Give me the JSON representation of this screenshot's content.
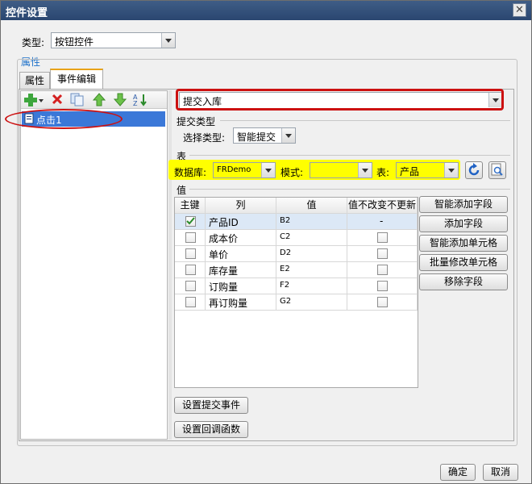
{
  "window": {
    "title": "控件设置",
    "close": "✕"
  },
  "type_row": {
    "label": "类型:",
    "value": "按钮控件"
  },
  "properties": {
    "section_label": "属性",
    "tabs": [
      "属性",
      "事件编辑"
    ],
    "active_tab": 1
  },
  "event_list": {
    "items": [
      "点击1"
    ]
  },
  "event_type": {
    "value": "提交入库"
  },
  "submit_type": {
    "group": "提交类型",
    "label": "选择类型:",
    "value": "智能提交"
  },
  "table_group": {
    "group": "表",
    "db_label": "数据库:",
    "db_value": "FRDemo",
    "mode_label": "模式:",
    "mode_value": "",
    "table_label": "表:",
    "table_value": "产品"
  },
  "values_group": {
    "group": "值",
    "headers": [
      "主键",
      "列",
      "值",
      "值不改变不更新"
    ],
    "rows": [
      {
        "key": true,
        "col": "产品ID",
        "val": "B2",
        "nochange": "-"
      },
      {
        "key": false,
        "col": "成本价",
        "val": "C2",
        "nochange": ""
      },
      {
        "key": false,
        "col": "单价",
        "val": "D2",
        "nochange": ""
      },
      {
        "key": false,
        "col": "库存量",
        "val": "E2",
        "nochange": ""
      },
      {
        "key": false,
        "col": "订购量",
        "val": "F2",
        "nochange": ""
      },
      {
        "key": false,
        "col": "再订购量",
        "val": "G2",
        "nochange": ""
      }
    ],
    "side_buttons": [
      "智能添加字段",
      "添加字段",
      "智能添加单元格",
      "批量修改单元格",
      "移除字段"
    ]
  },
  "bottom_buttons": {
    "submit_event": "设置提交事件",
    "callback": "设置回调函数"
  },
  "dialog_buttons": {
    "ok": "确定",
    "cancel": "取消"
  },
  "colors": {
    "highlight_red": "#cc1111",
    "highlight_yellow": "#ffff00",
    "selection_blue": "#3b78d8"
  }
}
